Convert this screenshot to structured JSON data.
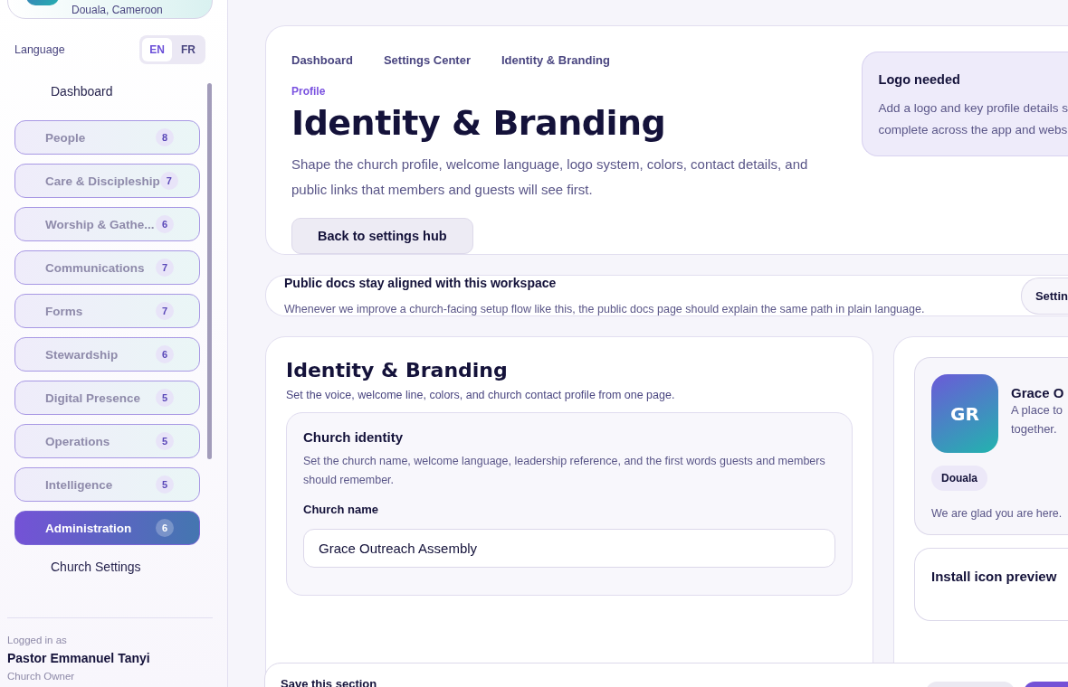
{
  "sidebar": {
    "church": {
      "location": "Douala, Cameroon"
    },
    "language": {
      "label": "Language",
      "options": [
        {
          "label": "EN",
          "selected": true
        },
        {
          "label": "FR",
          "selected": false
        }
      ]
    },
    "nav": [
      {
        "kind": "link",
        "label": "Dashboard"
      },
      {
        "kind": "group",
        "label": "People",
        "count": "8",
        "selected": false,
        "disabled": true
      },
      {
        "kind": "group",
        "label": "Care & Discipleship",
        "count": "7",
        "selected": false,
        "disabled": true
      },
      {
        "kind": "group",
        "label": "Worship & Gathe...",
        "count": "6",
        "selected": false,
        "disabled": true
      },
      {
        "kind": "group",
        "label": "Communications",
        "count": "7",
        "selected": false,
        "disabled": true
      },
      {
        "kind": "group",
        "label": "Forms",
        "count": "7",
        "selected": false,
        "disabled": true
      },
      {
        "kind": "group",
        "label": "Stewardship",
        "count": "6",
        "selected": false,
        "disabled": true
      },
      {
        "kind": "group",
        "label": "Digital Presence",
        "count": "5",
        "selected": false,
        "disabled": true
      },
      {
        "kind": "group",
        "label": "Operations",
        "count": "5",
        "selected": false,
        "disabled": true
      },
      {
        "kind": "group",
        "label": "Intelligence",
        "count": "5",
        "selected": false,
        "disabled": true
      },
      {
        "kind": "group",
        "label": "Administration",
        "count": "6",
        "selected": true,
        "disabled": false
      },
      {
        "kind": "link",
        "label": "Church Settings"
      }
    ],
    "user": {
      "caption": "Logged in as",
      "name": "Pastor Emmanuel Tanyi",
      "role": "Church Owner"
    }
  },
  "hero": {
    "breadcrumbs": [
      "Dashboard",
      "Settings Center",
      "Identity & Branding"
    ],
    "eyebrow": "Profile",
    "title": "Identity & Branding",
    "description": "Shape the church profile, welcome language, logo system, colors, contact details, and public links that members and guests will see first.",
    "button": "Back to settings hub",
    "notice": {
      "title": "Logo needed",
      "lines": [
        "Add a logo and key profile details s",
        "complete across the app and webs"
      ]
    }
  },
  "docs": {
    "title": "Public docs stay aligned with this workspace",
    "text": "Whenever we improve a church-facing setup flow like this, the public docs page should explain the same path in plain language.",
    "button": "Settin"
  },
  "editor": {
    "title": "Identity & Branding",
    "subtitle": "Set the voice, welcome line, colors, and church contact profile from one page.",
    "section": {
      "title": "Church identity",
      "text": "Set the church name, welcome language, leadership reference, and the first words guests and members should remember.",
      "field_label": "Church name",
      "field_value": "Grace Outreach Assembly"
    }
  },
  "preview": {
    "initials": "GR",
    "name": "Grace O",
    "lines": [
      "A place to",
      "together."
    ],
    "tag": "Douala",
    "welcome": "We are glad you are here.",
    "install_title": "Install icon preview"
  },
  "save_bar": {
    "title": "Save this section"
  }
}
